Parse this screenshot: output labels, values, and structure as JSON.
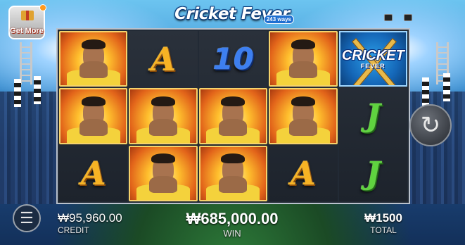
{
  "header": {
    "logo_text": "Cricket Fever",
    "logo_badge": "243 ways",
    "get_more_label": "Get More"
  },
  "reels": [
    [
      "player",
      "player",
      "A"
    ],
    [
      "A",
      "player",
      "player"
    ],
    [
      "10",
      "player",
      "player"
    ],
    [
      "player",
      "player",
      "A"
    ],
    [
      "wild",
      "J",
      "J"
    ]
  ],
  "symbols": {
    "wild_title": "CRICKET",
    "wild_sub": "FEVER",
    "letter_A": "A",
    "number_10": "10",
    "letter_J": "J"
  },
  "controls": {
    "spin_icon": "↻",
    "menu_icon": "☰"
  },
  "stats": {
    "credit_value": "₩95,960.00",
    "credit_label": "CREDIT",
    "win_value": "₩685,000.00",
    "win_label": "WIN",
    "total_value": "₩1500",
    "total_label": "TOTAL"
  },
  "colors": {
    "accent_gold": "#f7b324",
    "ten_blue": "#3d7ff0",
    "jay_green": "#5fd33f",
    "wild_blue": "#1567b8"
  }
}
